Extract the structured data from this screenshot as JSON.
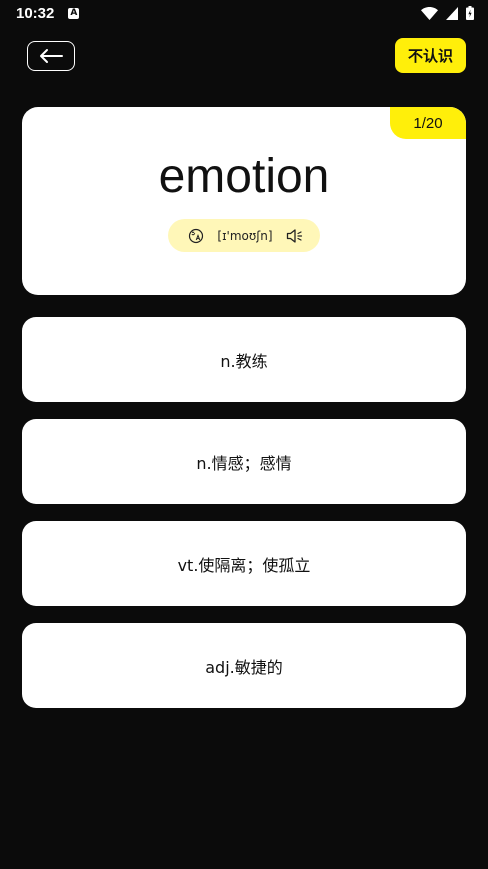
{
  "status_bar": {
    "time": "10:32",
    "notification_icon_letter": "A",
    "icons": [
      "wifi-icon",
      "signal-icon",
      "battery-icon"
    ]
  },
  "header": {
    "back_icon": "arrow-left-icon",
    "unknown_label": "不认识"
  },
  "word_card": {
    "progress": "1/20",
    "word": "emotion",
    "phonetic": "[ɪ'moʊʃn]",
    "accent_icon": "translate-icon",
    "audio_icon": "speaker-icon"
  },
  "options": [
    {
      "text": "n.教练"
    },
    {
      "text": "n.情感；感情"
    },
    {
      "text": "vt.使隔离；使孤立"
    },
    {
      "text": "adj.敏捷的"
    }
  ],
  "colors": {
    "background": "#0b0b0b",
    "accent": "#ffef0a",
    "pill": "#fff7b8",
    "card": "#ffffff"
  }
}
